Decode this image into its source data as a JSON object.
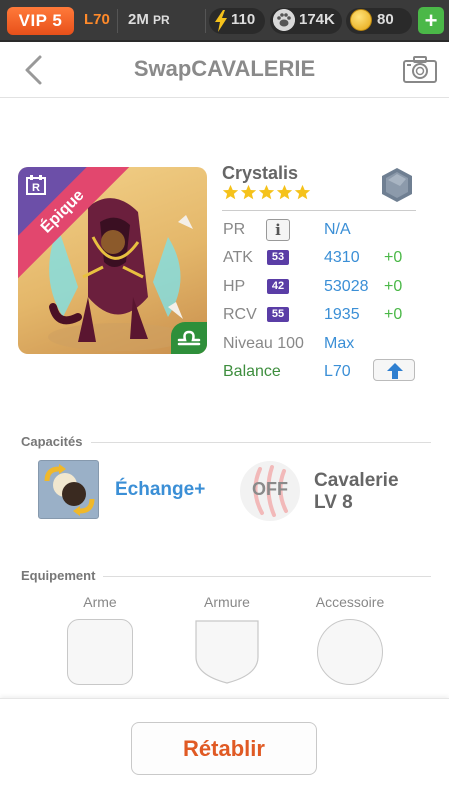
{
  "topbar": {
    "vip": "VIP 5",
    "level": "L70",
    "pr_value": "2M",
    "pr_unit": "PR",
    "energy": "110",
    "paw": "174K",
    "coins": "80",
    "add_label": "+",
    "colors": {
      "vip": "#e8501a",
      "level": "#ff8a2a",
      "add": "#4bb848"
    }
  },
  "header": {
    "title": "SwapCAVALERIE",
    "back_icon": "chevron-left-icon",
    "camera_icon": "camera-icon"
  },
  "character": {
    "name": "Crystalis",
    "rarity": "Épique",
    "stars": 5,
    "element_icon": "metal-hexagon-icon",
    "zodiac_icon": "libra-icon",
    "stats": [
      {
        "label": "PR",
        "badge": "",
        "value": "N/A",
        "bonus": ""
      },
      {
        "label": "ATK",
        "badge": "53",
        "value": "4310",
        "bonus": "+0"
      },
      {
        "label": "HP",
        "badge": "42",
        "value": "53028",
        "bonus": "+0"
      },
      {
        "label": "RCV",
        "badge": "55",
        "value": "1935",
        "bonus": "+0"
      },
      {
        "label": "Niveau 100",
        "badge": "",
        "value": "Max",
        "bonus": ""
      }
    ],
    "balance": {
      "label": "Balance",
      "value": "L70"
    },
    "colors": {
      "rarity_ribbon": "#e2476e",
      "stat_value": "#3b8fd6",
      "bonus": "#4bb848",
      "badge": "#5a3da6"
    }
  },
  "capacites": {
    "title": "Capacités",
    "active": {
      "name": "Échange+",
      "icon": "swap-orbs-icon"
    },
    "passive": {
      "state": "OFF",
      "name_line1": "Cavalerie",
      "name_line2": "LV 8",
      "icon": "claw-scratch-icon"
    }
  },
  "equipement": {
    "title": "Equipement",
    "slots": [
      {
        "label": "Arme"
      },
      {
        "label": "Armure"
      },
      {
        "label": "Accessoire"
      }
    ]
  },
  "footer": {
    "reset_label": "Rétablir",
    "reset_color": "#e05a24"
  }
}
